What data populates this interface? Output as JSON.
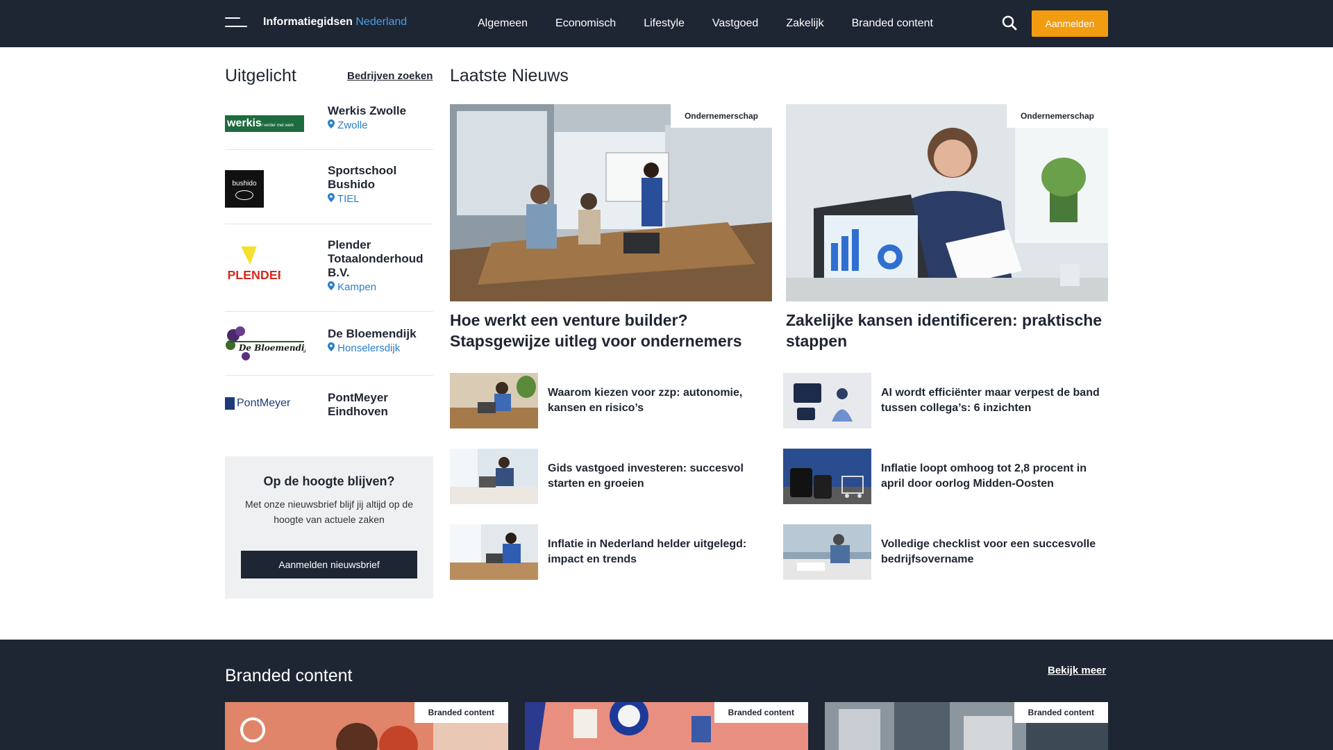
{
  "header": {
    "logo_main": "Informatiegidsen",
    "logo_accent": "Nederland",
    "nav": [
      "Algemeen",
      "Economisch",
      "Lifestyle",
      "Vastgoed",
      "Zakelijk",
      "Branded content"
    ],
    "login_label": "Aanmelden"
  },
  "featured": {
    "title": "Uitgelicht",
    "search_link": "Bedrijven zoeken",
    "companies": [
      {
        "name": "Werkis Zwolle",
        "city": "Zwolle",
        "logo_text": "werkis",
        "logo_sub": "/ verder met werk"
      },
      {
        "name": "Sportschool Bushido",
        "city": "TIEL",
        "logo_text": "bushido"
      },
      {
        "name": "Plender Totaalonderhoud B.V.",
        "city": "Kampen",
        "logo_text": "PLENDER"
      },
      {
        "name": "De Bloemendijk",
        "city": "Honselersdijk",
        "logo_text": "De Bloemendijk"
      },
      {
        "name": "PontMeyer Eindhoven",
        "city": "",
        "logo_text": "PontMeyer"
      }
    ]
  },
  "newsletter": {
    "title": "Op de hoogte blijven?",
    "text": "Met onze nieuwsbrief blijf jij altijd op de hoogte van actuele zaken",
    "button": "Aanmelden nieuwsbrief"
  },
  "news": {
    "title": "Laatste Nieuws",
    "main": [
      {
        "tag": "Ondernemerschap",
        "title": "Hoe werkt een venture builder? Stapsgewijze uitleg voor ondernemers"
      },
      {
        "tag": "Ondernemerschap",
        "title": "Zakelijke kansen identificeren: praktische stappen"
      }
    ],
    "list": [
      {
        "title": "Waarom kiezen voor zzp: autonomie, kansen en risico’s"
      },
      {
        "title": "AI wordt efficiënter maar verpest de band tussen collega’s: 6 inzichten"
      },
      {
        "title": "Gids vastgoed investeren: succesvol starten en groeien"
      },
      {
        "title": "Inflatie loopt omhoog tot 2,8 procent in april door oorlog Midden-Oosten"
      },
      {
        "title": "Inflatie in Nederland helder uitgelegd: impact en trends"
      },
      {
        "title": "Volledige checklist voor een succesvolle bedrijfsovername"
      }
    ]
  },
  "branded": {
    "title": "Branded content",
    "more": "Bekijk meer",
    "cards": [
      {
        "tag": "Branded content"
      },
      {
        "tag": "Branded content"
      },
      {
        "tag": "Branded content"
      }
    ]
  }
}
